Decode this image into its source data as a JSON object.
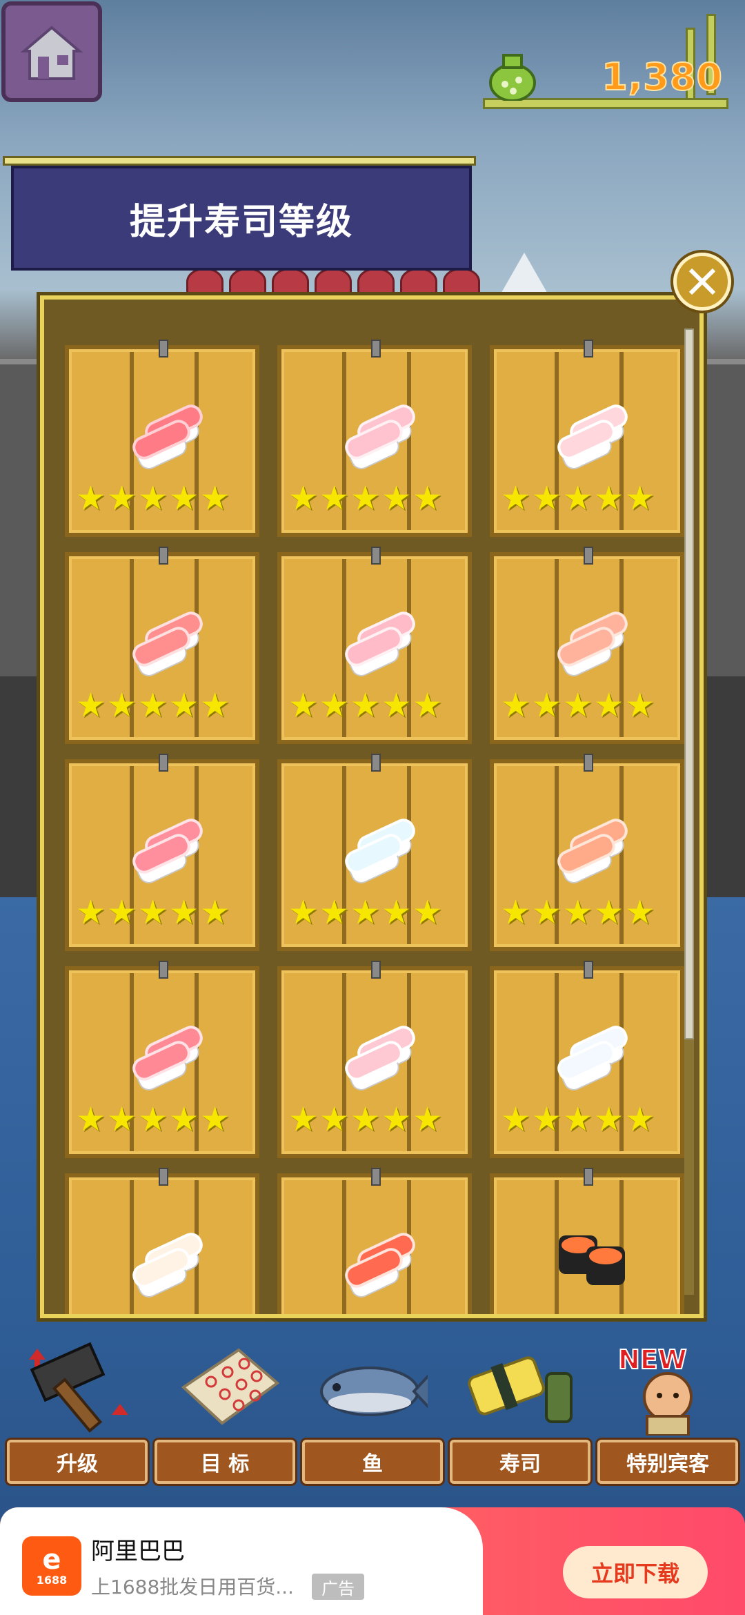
{
  "header": {
    "coins": "1,380"
  },
  "banner": {
    "title": "提升寿司等级"
  },
  "sushi_cards": [
    {
      "name": "tuna",
      "stars": "★★★★★",
      "colors": [
        "#ff7b86",
        "#ffd1d5"
      ]
    },
    {
      "name": "pink-fish",
      "stars": "★★★★★",
      "colors": [
        "#ffc2cf",
        "#fff0f4"
      ]
    },
    {
      "name": "white-pink-fish",
      "stars": "★★★★★",
      "colors": [
        "#ffd7dc",
        "#ffffff"
      ]
    },
    {
      "name": "sweet-shrimp",
      "stars": "★★★★★",
      "colors": [
        "#ff8f8f",
        "#ffe0e0"
      ]
    },
    {
      "name": "sea-bream",
      "stars": "★★★★★",
      "colors": [
        "#ffbcc8",
        "#fff1f3"
      ]
    },
    {
      "name": "shrimp-pale",
      "stars": "★★★★★",
      "colors": [
        "#ffb39c",
        "#ffe6dc"
      ]
    },
    {
      "name": "fatty-tuna",
      "stars": "★★★★★",
      "colors": [
        "#ff8f9c",
        "#ffe3e7"
      ]
    },
    {
      "name": "squid",
      "stars": "★★★★★",
      "colors": [
        "#e8f8ff",
        "#ffffff"
      ]
    },
    {
      "name": "salmon",
      "stars": "★★★★★",
      "colors": [
        "#ffab8a",
        "#ffe6d8"
      ]
    },
    {
      "name": "red-clam",
      "stars": "★★★★★",
      "colors": [
        "#ff8a96",
        "#ffe2e6"
      ]
    },
    {
      "name": "flounder",
      "stars": "★★★★★",
      "colors": [
        "#ffc9d3",
        "#ffffff"
      ]
    },
    {
      "name": "white-squid",
      "stars": "★★★★★",
      "colors": [
        "#f4f8ff",
        "#ffffff"
      ]
    },
    {
      "name": "scallop",
      "stars": "",
      "colors": [
        "#fff3e6",
        "#ffffff"
      ]
    },
    {
      "name": "shrimp",
      "stars": "",
      "colors": [
        "#ff6a50",
        "#ffe4dc"
      ]
    },
    {
      "name": "salmon-roe-gunkan",
      "stars": "",
      "colors": [
        "#ff7a3c",
        "#222222"
      ]
    }
  ],
  "menu": [
    {
      "label": "升级",
      "icon": "hammer-icon"
    },
    {
      "label": "目  标",
      "icon": "target-chart-icon"
    },
    {
      "label": "鱼",
      "icon": "fish-icon"
    },
    {
      "label": "寿司",
      "icon": "sushi-icon"
    },
    {
      "label": "特别宾客",
      "icon": "guest-icon",
      "badge": "NEW"
    }
  ],
  "ad": {
    "logo_text": "1688",
    "title": "阿里巴巴",
    "description": "上1688批发日用百货...",
    "tag": "广告",
    "button": "立即下载"
  }
}
